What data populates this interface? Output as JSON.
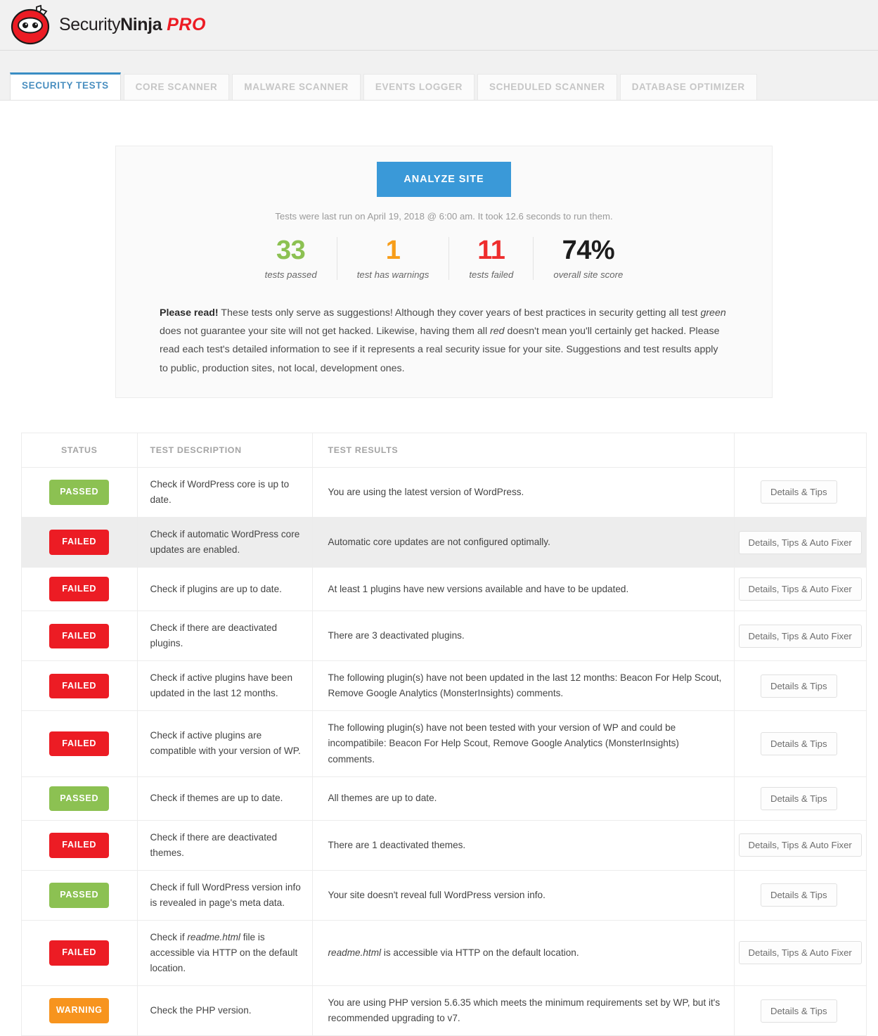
{
  "header": {
    "brand_primary": "SecurityNinja",
    "brand_sec": "Security",
    "brand_bold": "Ninja",
    "brand_pro": "PRO",
    "logo_icon": "ninja-mask-icon",
    "bg_color": "#f1f1f1"
  },
  "tabs": [
    {
      "label": "SECURITY TESTS",
      "active": true
    },
    {
      "label": "CORE SCANNER",
      "active": false
    },
    {
      "label": "MALWARE SCANNER",
      "active": false
    },
    {
      "label": "EVENTS LOGGER",
      "active": false
    },
    {
      "label": "SCHEDULED SCANNER",
      "active": false
    },
    {
      "label": "DATABASE OPTIMIZER",
      "active": false
    }
  ],
  "summary": {
    "analyze_button": "ANALYZE SITE",
    "analyze_color": "#3a99d8",
    "last_run": "Tests were last run on April 19, 2018 @ 6:00 am. It took 12.6 seconds to run them.",
    "stats": [
      {
        "value": "33",
        "label": "tests passed",
        "color": "#8cc152"
      },
      {
        "value": "1",
        "label": "test has warnings",
        "color": "#f79d19"
      },
      {
        "value": "11",
        "label": "tests failed",
        "color": "#ee2d2d"
      },
      {
        "value": "74%",
        "label": "overall site score",
        "color": "#1d1d1d"
      }
    ],
    "note_lead": "Please read!",
    "note_p1": " These tests only serve as suggestions! Although they cover years of best practices in security getting all test ",
    "note_em1": "green",
    "note_p2": " does not guarantee your site will not get hacked. Likewise, having them all ",
    "note_em2": "red",
    "note_p3": " doesn't mean you'll certainly get hacked. Please read each test's detailed information to see if it represents a real security issue for your site. Suggestions and test results apply to public, production sites, not local, development ones."
  },
  "table": {
    "columns": [
      "STATUS",
      "TEST DESCRIPTION",
      "TEST RESULTS",
      ""
    ],
    "rows": [
      {
        "status": "PASSED",
        "status_kind": "passed",
        "description": "Check if WordPress core is up to date.",
        "result": "You are using the latest version of WordPress.",
        "action": "Details & Tips",
        "highlight": false
      },
      {
        "status": "FAILED",
        "status_kind": "failed",
        "description": "Check if automatic WordPress core updates are enabled.",
        "result": "Automatic core updates are not configured optimally.",
        "action": "Details, Tips & Auto Fixer",
        "highlight": true
      },
      {
        "status": "FAILED",
        "status_kind": "failed",
        "description": "Check if plugins are up to date.",
        "result": "At least 1 plugins have new versions available and have to be updated.",
        "action": "Details, Tips & Auto Fixer",
        "highlight": false
      },
      {
        "status": "FAILED",
        "status_kind": "failed",
        "description": "Check if there are deactivated plugins.",
        "result": "There are 3 deactivated plugins.",
        "action": "Details, Tips & Auto Fixer",
        "highlight": false
      },
      {
        "status": "FAILED",
        "status_kind": "failed",
        "description": "Check if active plugins have been updated in the last 12 months.",
        "result": "The following plugin(s) have not been updated in the last 12 months: Beacon For Help Scout, Remove Google Analytics (MonsterInsights) comments.",
        "action": "Details & Tips",
        "highlight": false
      },
      {
        "status": "FAILED",
        "status_kind": "failed",
        "description": "Check if active plugins are compatible with your version of WP.",
        "result": "The following plugin(s) have not been tested with your version of WP and could be incompatibile: Beacon For Help Scout, Remove Google Analytics (MonsterInsights) comments.",
        "action": "Details & Tips",
        "highlight": false
      },
      {
        "status": "PASSED",
        "status_kind": "passed",
        "description": "Check if themes are up to date.",
        "result": "All themes are up to date.",
        "action": "Details & Tips",
        "highlight": false
      },
      {
        "status": "FAILED",
        "status_kind": "failed",
        "description": "Check if there are deactivated themes.",
        "result": "There are 1 deactivated themes.",
        "action": "Details, Tips & Auto Fixer",
        "highlight": false
      },
      {
        "status": "PASSED",
        "status_kind": "passed",
        "description": "Check if full WordPress version info is revealed in page's meta data.",
        "result": "Your site doesn't reveal full WordPress version info.",
        "action": "Details & Tips",
        "highlight": false
      },
      {
        "status": "FAILED",
        "status_kind": "failed",
        "description_pre": "Check if ",
        "description_em": "readme.html",
        "description_post": " file is accessible via HTTP on the default location.",
        "description": "Check if readme.html file is accessible via HTTP on the default location.",
        "result_em": "readme.html",
        "result_post": " is accessible via HTTP on the default location.",
        "result": "readme.html is accessible via HTTP on the default location.",
        "action": "Details, Tips & Auto Fixer",
        "highlight": false
      },
      {
        "status": "WARNING",
        "status_kind": "warning",
        "description": "Check the PHP version.",
        "result": "You are using PHP version 5.6.35 which meets the minimum requirements set by WP, but it's recommended upgrading to v7.",
        "action": "Details & Tips",
        "highlight": false
      }
    ]
  }
}
